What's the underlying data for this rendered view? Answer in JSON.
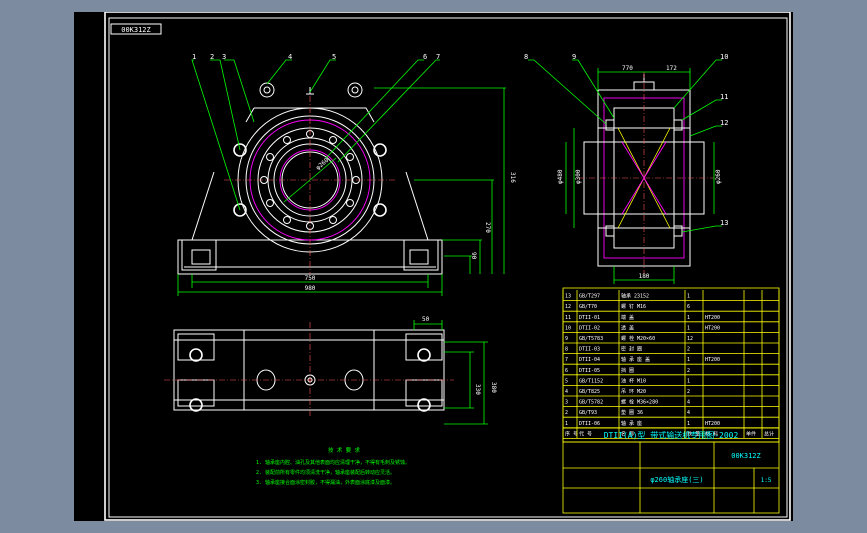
{
  "drawing": {
    "stamp": "00K312Z",
    "balloons": [
      "1",
      "2",
      "3",
      "4",
      "5",
      "6",
      "7",
      "8",
      "9",
      "10",
      "11",
      "12",
      "13"
    ],
    "dims_front": {
      "overall_height": "316",
      "height_mid": "270",
      "height_low": "90",
      "diameter": "φ260",
      "base_inner": "750",
      "base_outer": "980"
    },
    "dims_side": {
      "top_left": "770",
      "top_right": "172",
      "bore_left": "φ480",
      "bore_left2": "φ300",
      "bore_right": "φ260",
      "bottom": "180"
    },
    "dims_top": {
      "flange": "50",
      "height_outer": "380",
      "height_inner": "330"
    },
    "notes": {
      "title": "技 术 要 求",
      "lines": [
        "1. 轴承座内腔、油孔及其他表面均应清理干净，不得有毛刺及锈蚀。",
        "2. 装配前所有零件均须清洗干净，轴承座装配后转动应灵活。",
        "3. 轴承座接合面涂密封胶，不得漏油，外表面涂底漆及面漆。"
      ]
    }
  },
  "title_block": {
    "parts_table": [
      [
        "13",
        "GB/T297",
        "轴承 23152",
        "1",
        "",
        "",
        ""
      ],
      [
        "12",
        "GB/T70",
        "螺 钉 M16",
        "6",
        "",
        "",
        ""
      ],
      [
        "11",
        "DTII-01",
        "端 盖",
        "1",
        "HT200",
        "",
        ""
      ],
      [
        "10",
        "DTII-02",
        "透 盖",
        "1",
        "HT200",
        "",
        ""
      ],
      [
        "9",
        "GB/T5783",
        "螺 栓 M20×60",
        "12",
        "",
        "",
        ""
      ],
      [
        "8",
        "DTII-03",
        "密 封 圈",
        "2",
        "",
        "",
        ""
      ],
      [
        "7",
        "DTII-04",
        "轴 承 座 盖",
        "1",
        "HT200",
        "",
        ""
      ],
      [
        "6",
        "DTII-05",
        "挡 圈",
        "2",
        "",
        "",
        ""
      ],
      [
        "5",
        "GB/T1152",
        "油 杯 M10",
        "1",
        "",
        "",
        ""
      ],
      [
        "4",
        "GB/T825",
        "吊 环 M20",
        "2",
        "",
        "",
        ""
      ],
      [
        "3",
        "GB/T5782",
        "螺 栓 M36×280",
        "4",
        "",
        "",
        ""
      ],
      [
        "2",
        "GB/T93",
        "垫 圈 36",
        "4",
        "",
        "",
        ""
      ],
      [
        "1",
        "DTII-06",
        "轴 承 座",
        "1",
        "HT200",
        "",
        ""
      ]
    ],
    "header": [
      "序 号",
      "代 号",
      "名 称",
      "数 量",
      "材 料",
      "单件",
      "总计"
    ],
    "project": "DTII(A)型 带式输送机专用图-2002",
    "code": "00K312Z",
    "drawing_name": "φ260轴承座(三)",
    "scale": "1:5"
  }
}
